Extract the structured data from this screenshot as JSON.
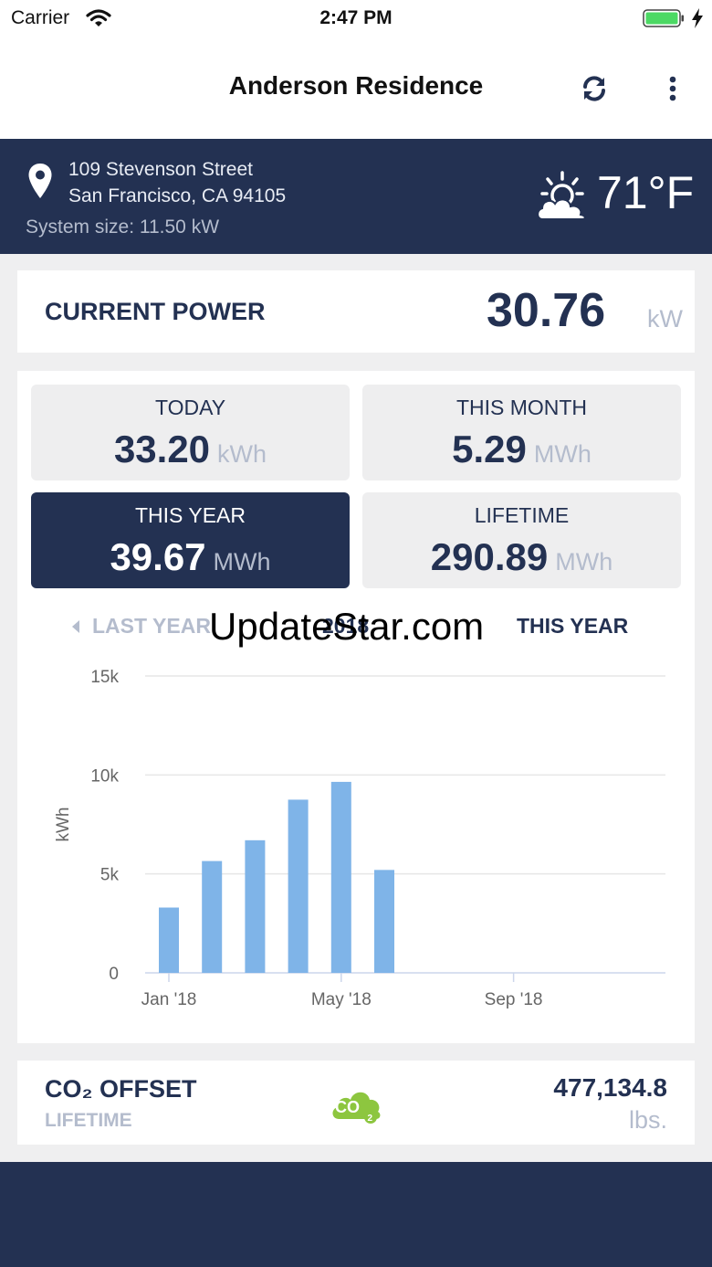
{
  "status_bar": {
    "carrier": "Carrier",
    "time": "2:47 PM"
  },
  "nav": {
    "title": "Anderson Residence"
  },
  "location": {
    "address_line1": "109 Stevenson Street",
    "address_line2": "San Francisco, CA 94105",
    "system_size": "System size: 11.50 kW",
    "temperature": "71°F"
  },
  "current_power": {
    "label": "CURRENT POWER",
    "value": "30.76",
    "unit": "kW"
  },
  "tiles": [
    {
      "label": "TODAY",
      "value": "33.20",
      "unit": "kWh",
      "selected": false
    },
    {
      "label": "THIS MONTH",
      "value": "5.29",
      "unit": "MWh",
      "selected": false
    },
    {
      "label": "THIS YEAR",
      "value": "39.67",
      "unit": "MWh",
      "selected": true
    },
    {
      "label": "LIFETIME",
      "value": "290.89",
      "unit": "MWh",
      "selected": false
    }
  ],
  "year_nav": {
    "prev": "LAST YEAR",
    "current": "2018",
    "next": "THIS YEAR"
  },
  "watermark": "UpdateStar.com",
  "chart_data": {
    "type": "bar",
    "ylabel": "kWh",
    "ylim": [
      0,
      15000
    ],
    "y_ticks": [
      {
        "value": 0,
        "label": "0"
      },
      {
        "value": 5000,
        "label": "5k"
      },
      {
        "value": 10000,
        "label": "10k"
      },
      {
        "value": 15000,
        "label": "15k"
      }
    ],
    "x_ticks": [
      {
        "month": 1,
        "label": "Jan '18"
      },
      {
        "month": 5,
        "label": "May '18"
      },
      {
        "month": 9,
        "label": "Sep '18"
      }
    ],
    "months": [
      1,
      2,
      3,
      4,
      5,
      6
    ],
    "values": [
      3300,
      5650,
      6700,
      8750,
      9650,
      5200
    ],
    "bar_color": "#7fb4e8",
    "grid": true
  },
  "co2": {
    "label": "CO₂ OFFSET",
    "sublabel": "LIFETIME",
    "value": "477,134.8",
    "unit": "lbs.",
    "icon_text": "CO",
    "icon_sub": "2"
  },
  "colors": {
    "brand_navy": "#233152",
    "muted": "#b4bccd",
    "bar": "#7fb4e8",
    "co2_green": "#8dc63f"
  }
}
